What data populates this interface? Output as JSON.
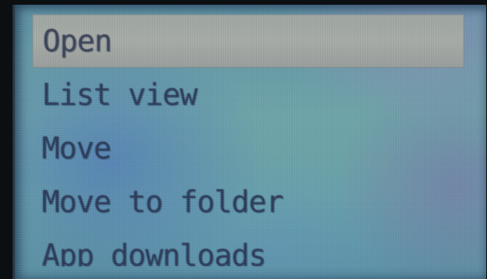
{
  "menu": {
    "items": [
      {
        "label": "Open",
        "selected": true
      },
      {
        "label": "List view",
        "selected": false
      },
      {
        "label": "Move",
        "selected": false
      },
      {
        "label": "Move to folder",
        "selected": false
      },
      {
        "label": "App downloads",
        "selected": false
      }
    ]
  },
  "colors": {
    "screen_background": "#6aa2a6",
    "selection_highlight": "#a3a8a5",
    "text": "#2c3b58"
  }
}
